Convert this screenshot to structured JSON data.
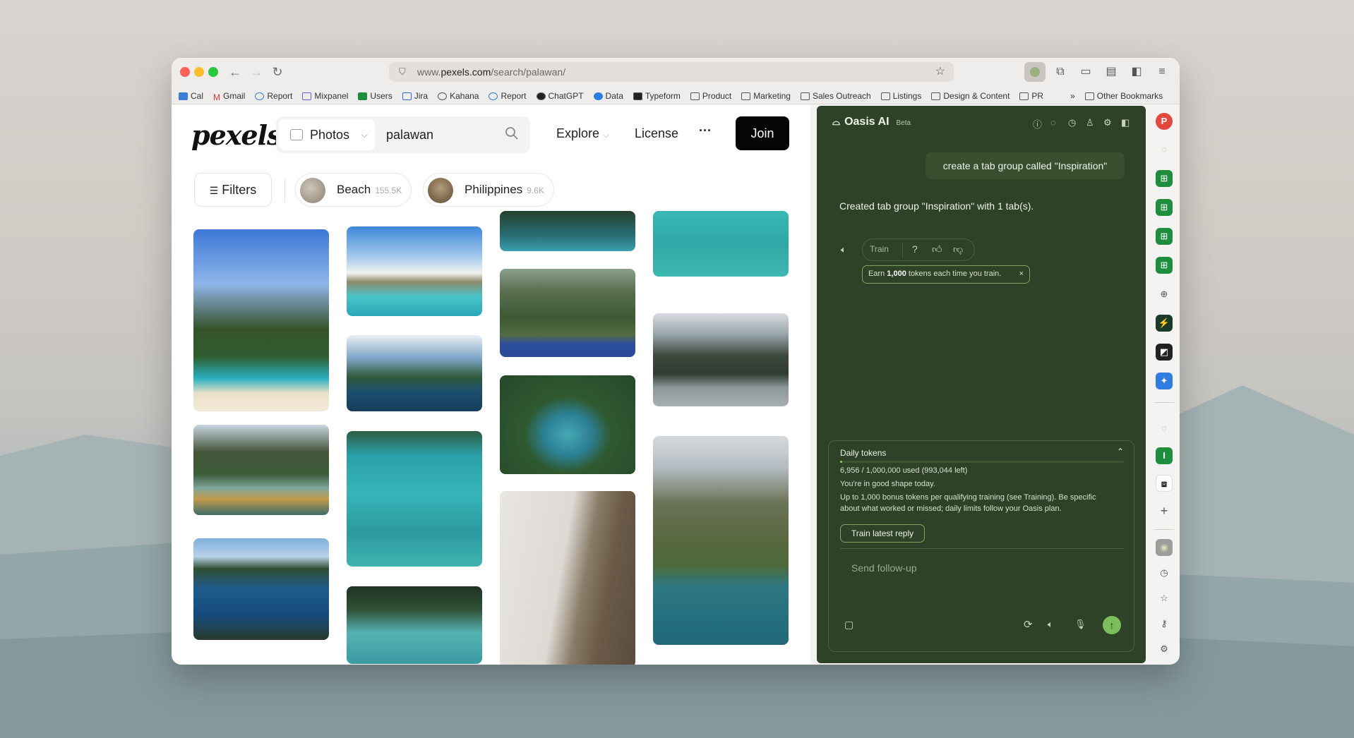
{
  "browser": {
    "url_prefix": "www.",
    "url_host": "pexels.com",
    "url_path": "/search/palawan/",
    "bookmarks": [
      "Cal",
      "Gmail",
      "Report",
      "Mixpanel",
      "Users",
      "Jira",
      "Kahana",
      "Report",
      "ChatGPT",
      "Data",
      "Typeform",
      "Product",
      "Marketing",
      "Sales Outreach",
      "Listings",
      "Design & Content",
      "PR"
    ],
    "other_bookmarks": "Other Bookmarks"
  },
  "pexels": {
    "logo": "pexels",
    "search_type": "Photos",
    "search_value": "palawan",
    "explore": "Explore",
    "license": "License",
    "more": "···",
    "join": "Join",
    "filters": "Filters",
    "chips": [
      {
        "label": "Beach",
        "count": "155.5K"
      },
      {
        "label": "Philippines",
        "count": "9.6K"
      }
    ]
  },
  "ai": {
    "title": "Oasis AI",
    "badge": "Beta",
    "user_message": "create a tab group called \"Inspiration\"",
    "reply": "Created tab group \"Inspiration\" with 1 tab(s).",
    "train": "Train",
    "earn_pre": "Earn ",
    "earn_bold": "1,000",
    "earn_post": " tokens each time you train.",
    "daily": {
      "title": "Daily tokens",
      "usage": "6,956 / 1,000,000 used (993,044 left)",
      "progress": 0.007,
      "status": "You're in good shape today.",
      "bonus1": "Up to 1,000 bonus tokens per qualifying training (see Training). Be specific",
      "bonus2": "about what worked or missed; daily limits follow your Oasis plan.",
      "train_latest": "Train latest reply"
    },
    "placeholder": "Send follow-up"
  }
}
